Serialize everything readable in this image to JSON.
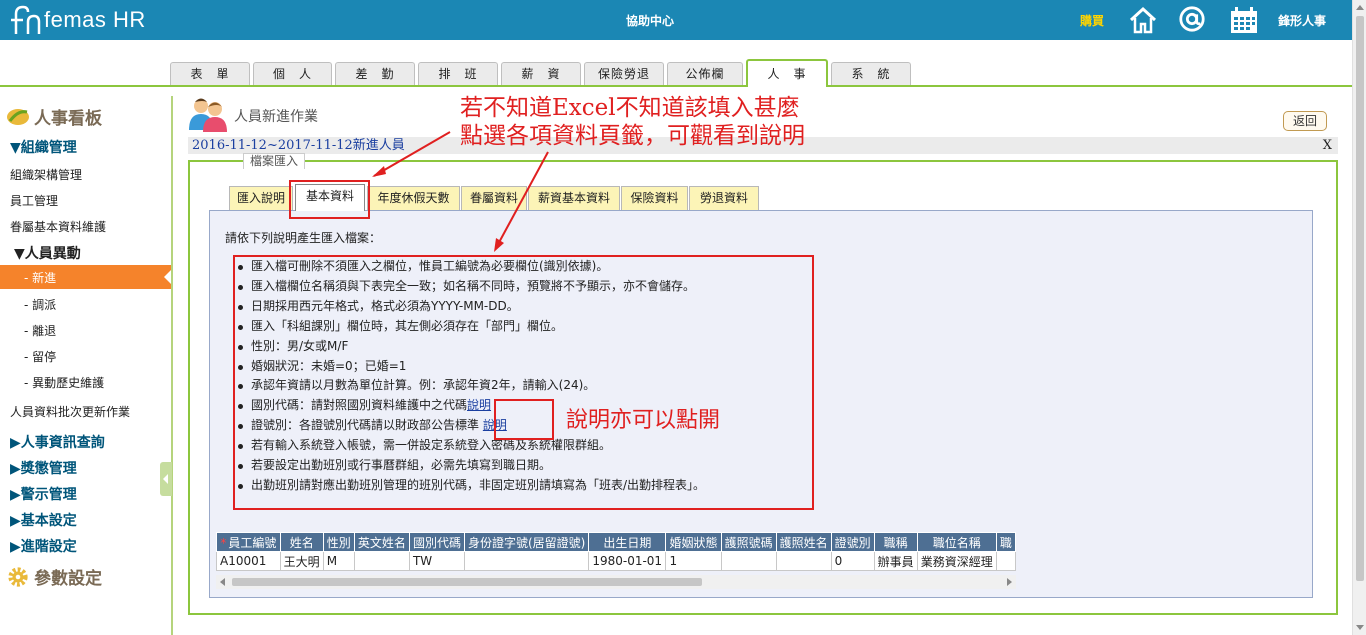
{
  "header": {
    "logo_text": "femas HR",
    "center_title": "協助中心",
    "buy_label": "購買",
    "company_name": "鋒形人事"
  },
  "top_tabs": [
    {
      "label": "表　單"
    },
    {
      "label": "個　人"
    },
    {
      "label": "差　勤"
    },
    {
      "label": "排　班"
    },
    {
      "label": "薪　資"
    },
    {
      "label": "保險勞退"
    },
    {
      "label": "公佈欄"
    },
    {
      "label": "人　事",
      "active": true
    },
    {
      "label": "系　統"
    }
  ],
  "sidebar": {
    "main_title": "人事看板",
    "group_org": "▼組織管理",
    "org_items": [
      "組織架構管理",
      "員工管理",
      "眷屬基本資料維護"
    ],
    "group_change": "▼人員異動",
    "change_items": [
      "- 新進",
      "- 調派",
      "- 離退",
      "- 留停",
      "- 異動歷史維護"
    ],
    "batch_update": "人員資料批次更新作業",
    "groups": [
      "▶人事資訊查詢",
      "▶獎懲管理",
      "▶警示管理",
      "▶基本設定",
      "▶進階設定"
    ],
    "settings_title": "參數設定"
  },
  "page": {
    "title": "人員新進作業",
    "back_label": "返回",
    "range_text": "2016-11-12~2017-11-12新進人員",
    "close_label": "X",
    "legend": "檔案匯入"
  },
  "inner_tabs": [
    {
      "label": "匯入說明"
    },
    {
      "label": "基本資料",
      "active": true
    },
    {
      "label": "年度休假天數"
    },
    {
      "label": "眷屬資料"
    },
    {
      "label": "薪資基本資料"
    },
    {
      "label": "保險資料"
    },
    {
      "label": "勞退資料"
    }
  ],
  "panel": {
    "intro": "請依下列說明產生匯入檔案：",
    "notes": [
      "匯入檔可刪除不須匯入之欄位，惟員工編號為必要欄位(識別依據)。",
      "匯入檔欄位名稱須與下表完全一致；如名稱不同時，預覽將不予顯示，亦不會儲存。",
      "日期採用西元年格式，格式必須為YYYY-MM-DD。",
      "匯入「科組課別」欄位時，其左側必須存在「部門」欄位。",
      "性別：男/女或M/F",
      "婚姻狀況：未婚=0；已婚=1",
      "承認年資請以月數為單位計算。例：承認年資2年，請輸入(24)。",
      "國別代碼：請對照國別資料維護中之代碼",
      "證號別：各證號別代碼請以財政部公告標準",
      "若有輸入系統登入帳號，需一併設定系統登入密碼及系統權限群組。",
      "若要設定出勤班別或行事曆群組，必需先填寫到職日期。",
      "出勤班別請對應出勤班別管理的班別代碼，非固定班別請填寫為「班表/出勤排程表」。"
    ],
    "link_label": "說明"
  },
  "annotations": {
    "line1": "若不知道Excel不知道該填入甚麼",
    "line2": "點選各項資料頁籤，可觀看到說明",
    "side_note": "說明亦可以點開"
  },
  "sample_table": {
    "headers": [
      "員工編號",
      "姓名",
      "性別",
      "英文姓名",
      "國別代碼",
      "身份證字號(居留證號)",
      "出生日期",
      "婚姻狀態",
      "護照號碼",
      "護照姓名",
      "證號別",
      "職稱",
      "職位名稱",
      "職"
    ],
    "rows": [
      [
        "A10001",
        "王大明",
        "M",
        "",
        "TW",
        "",
        "1980-01-01",
        "1",
        "",
        "",
        "0",
        "辦事員",
        "業務資深經理",
        ""
      ]
    ]
  },
  "colors": {
    "header_bg": "#1b87b4",
    "accent_green": "#8cc63e",
    "active_orange": "#f5832b",
    "annotation_red": "#e02020",
    "table_header": "#4e6f93"
  }
}
